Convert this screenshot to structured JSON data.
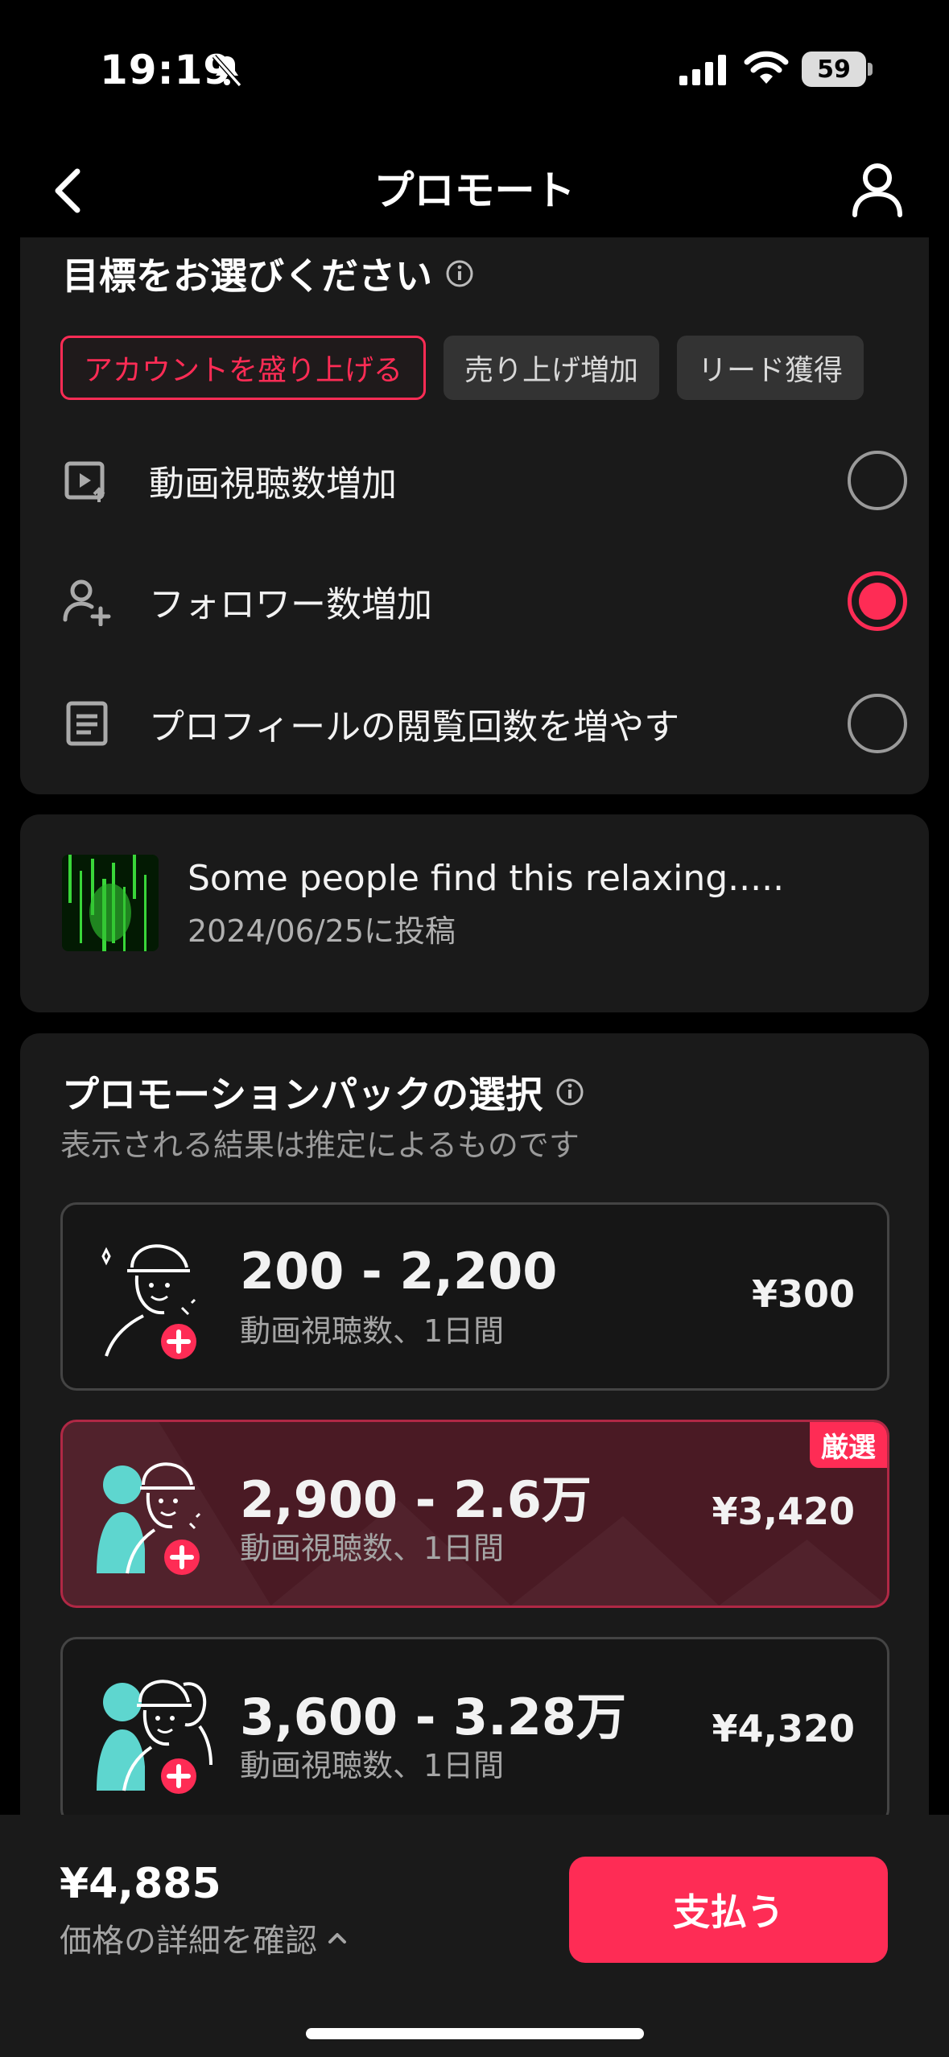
{
  "status_bar": {
    "time": "19:19",
    "battery": "59"
  },
  "header": {
    "title": "プロモート",
    "back_icon": "chevron-left-icon",
    "profile_icon": "person-icon"
  },
  "goal_section": {
    "title": "目標をお選びください",
    "chips": [
      {
        "label": "アカウントを盛り上げる",
        "active": true
      },
      {
        "label": "売り上げ増加",
        "active": false
      },
      {
        "label": "リード獲得",
        "active": false
      }
    ],
    "options": [
      {
        "label": "動画視聴数増加",
        "icon": "video-play-icon",
        "selected": false
      },
      {
        "label": "フォロワー数増加",
        "icon": "add-user-icon",
        "selected": true
      },
      {
        "label": "プロフィールの閲覧回数を増やす",
        "icon": "document-icon",
        "selected": false
      }
    ]
  },
  "video": {
    "title": "Some people find this relaxing.....",
    "date": "2024/06/25に投稿"
  },
  "packs_section": {
    "title": "プロモーションパックの選択",
    "subtitle": "表示される結果は推定によるものです",
    "packs": [
      {
        "range": "200 - 2,200",
        "desc": "動画視聴数、1日間",
        "price": "¥300",
        "badge": "",
        "selected": false
      },
      {
        "range": "2,900 - 2.6万",
        "desc": "動画視聴数、1日間",
        "price": "¥3,420",
        "badge": "厳選",
        "selected": true
      },
      {
        "range": "3,600 - 3.28万",
        "desc": "動画視聴数、1日間",
        "price": "¥4,320",
        "badge": "",
        "selected": false
      }
    ]
  },
  "bottom_bar": {
    "total": "¥4,885",
    "details_label": "価格の詳細を確認",
    "pay_label": "支払う"
  },
  "colors": {
    "accent": "#fe2c55",
    "card": "#1a1a1a",
    "background": "#000000",
    "teal": "#5ed6cf"
  }
}
